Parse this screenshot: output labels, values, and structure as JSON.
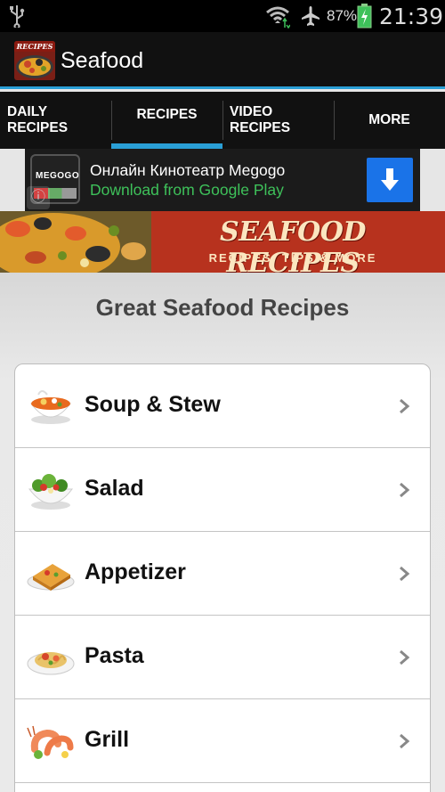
{
  "status_bar": {
    "battery_percent": "87%",
    "time": "21:39",
    "icons": [
      "usb-icon",
      "wifi-icon",
      "airplane-icon",
      "battery-charging-icon"
    ]
  },
  "action_bar": {
    "app_icon_label": "RECIPES",
    "title": "Seafood"
  },
  "tabs": [
    {
      "label": "DAILY RECIPES",
      "active": false
    },
    {
      "label": "RECIPES",
      "active": true
    },
    {
      "label": "VIDEO RECIPES",
      "active": false
    },
    {
      "label": "MORE",
      "active": false
    }
  ],
  "ad": {
    "logo_text": "MEGOGO",
    "title": "Онлайн Кинотеатр Megogo",
    "subtitle": "Download from Google Play",
    "info_icon": "info-icon",
    "download_icon": "download-arrow-icon"
  },
  "hero": {
    "title": "SEAFOOD RECIPES",
    "subtitle": "RECIPES, TIPS & MORE"
  },
  "main": {
    "section_title": "Great Seafood Recipes",
    "categories": [
      {
        "label": "Soup & Stew",
        "icon": "soup-bowl-icon"
      },
      {
        "label": "Salad",
        "icon": "salad-bowl-icon"
      },
      {
        "label": "Appetizer",
        "icon": "appetizer-plate-icon"
      },
      {
        "label": "Pasta",
        "icon": "pasta-plate-icon"
      },
      {
        "label": "Grill",
        "icon": "grilled-shrimp-icon"
      }
    ]
  },
  "colors": {
    "accent": "#2a9fd6",
    "hero_red": "#b7321e",
    "ad_green": "#3ec15a",
    "download_blue": "#1a73e8"
  }
}
